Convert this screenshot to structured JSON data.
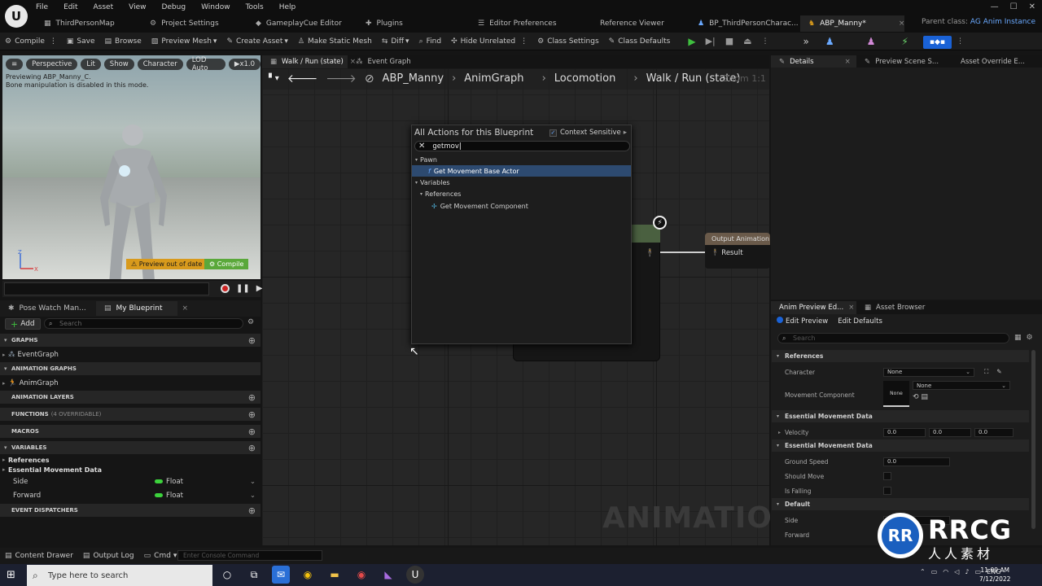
{
  "menu": [
    "File",
    "Edit",
    "Asset",
    "View",
    "Debug",
    "Window",
    "Tools",
    "Help"
  ],
  "tabs": [
    {
      "label": "ThirdPersonMap",
      "icon": "map-icon"
    },
    {
      "label": "Project Settings",
      "icon": "settings-icon"
    },
    {
      "label": "GameplayCue Editor",
      "icon": "cue-icon"
    },
    {
      "label": "Plugins",
      "icon": "plugin-icon"
    },
    {
      "label": "Editor Preferences",
      "icon": "prefs-icon"
    },
    {
      "label": "Reference Viewer",
      "icon": "reference-icon"
    },
    {
      "label": "BP_ThirdPersonCharac...",
      "icon": "blueprint-icon"
    },
    {
      "label": "ABP_Manny*",
      "icon": "anim-blueprint-icon",
      "close": "×"
    }
  ],
  "parent_class": {
    "prefix": "Parent class:",
    "value": "AG Anim Instance"
  },
  "window_controls": [
    "—",
    "☐",
    "✕"
  ],
  "toolbar": {
    "compile": "Compile",
    "save": "Save",
    "browse": "Browse",
    "preview_mesh": "Preview Mesh",
    "create_asset": "Create Asset",
    "make_static_mesh": "Make Static Mesh",
    "diff": "Diff",
    "find": "Find",
    "hide_unrelated": "Hide Unrelated",
    "class_settings": "Class Settings",
    "class_defaults": "Class Defaults"
  },
  "viewport": {
    "buttons": [
      "Perspective",
      "Lit",
      "Show",
      "Character",
      "LOD Auto",
      "x1.0"
    ],
    "info_line1": "Previewing ABP_Manny_C.",
    "info_line2": "Bone manipulation is disabled in this mode.",
    "warning": "Preview out of date",
    "compile": "Compile",
    "axis_z": "Z",
    "axis_x": "X"
  },
  "left_tabs": [
    "Pose Watch Man...",
    "My Blueprint"
  ],
  "my_blueprint": {
    "add": "Add",
    "search_placeholder": "Search",
    "graphs": "GRAPHS",
    "event_graph": "EventGraph",
    "animation_graphs": "ANIMATION GRAPHS",
    "anim_graph": "AnimGraph",
    "animation_layers": "ANIMATION LAYERS",
    "functions": "FUNCTIONS",
    "functions_sub": "(4 OVERRIDABLE)",
    "macros": "MACROS",
    "variables": "VARIABLES",
    "cat_references": "References",
    "cat_movement": "Essential Movement Data",
    "vars": [
      {
        "name": "Side",
        "type": "Float"
      },
      {
        "name": "Forward",
        "type": "Float"
      }
    ],
    "event_dispatchers": "EVENT DISPATCHERS"
  },
  "graph_tabs": [
    "Walk / Run (state)",
    "Event Graph"
  ],
  "breadcrumbs": [
    "ABP_Manny",
    "AnimGraph",
    "Locomotion",
    "Walk / Run (state)"
  ],
  "zoom": "Zoom 1:1",
  "graph_watermark": "ANIMATION",
  "output_node": {
    "title": "Output Animation",
    "pin": "Result"
  },
  "actions": {
    "title": "All Actions for this Blueprint",
    "context_label": "Context Sensitive",
    "search_value": "getmov",
    "cat_pawn": "Pawn",
    "item1": "Get Movement Base Actor",
    "cat_variables": "Variables",
    "cat_references": "References",
    "item2": "Get Movement Component"
  },
  "right_tabs": [
    "Details",
    "Preview Scene S...",
    "Asset Override E..."
  ],
  "anim_preview_tabs": [
    "Anim Preview Ed...",
    "Asset Browser"
  ],
  "anim_preview": {
    "edit_preview": "Edit Preview",
    "edit_defaults": "Edit Defaults",
    "search_placeholder": "Search",
    "references": "References",
    "character": "Character",
    "character_value": "None",
    "movement_component": "Movement Component",
    "movement_thumb": "None",
    "movement_value": "None",
    "essential1": "Essential Movement Data",
    "velocity": "Velocity",
    "velocity_values": [
      "0.0",
      "0.0",
      "0.0"
    ],
    "essential2": "Essential Movement Data",
    "ground_speed": "Ground Speed",
    "ground_speed_value": "0.0",
    "should_move": "Should Move",
    "is_falling": "Is Falling",
    "default": "Default",
    "side": "Side",
    "forward": "Forward"
  },
  "statusbar": {
    "content_drawer": "Content Drawer",
    "output_log": "Output Log",
    "cmd": "Cmd",
    "console_placeholder": "Enter Console Command"
  },
  "taskbar": {
    "search_placeholder": "Type here to search",
    "lang": "ENG",
    "time": "11:09 AM",
    "date": "7/12/2022"
  },
  "watermark": {
    "brand": "RRCG",
    "sub": "人人素材",
    "logo_letters": "RR"
  }
}
